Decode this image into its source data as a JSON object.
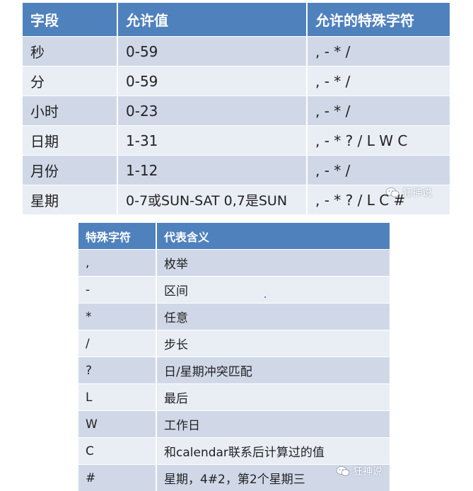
{
  "fields_table": {
    "headers": [
      "字段",
      "允许值",
      "允许的特殊字符"
    ],
    "rows": [
      [
        "秒",
        "0-59",
        ", - * /"
      ],
      [
        "分",
        "0-59",
        ", - * /"
      ],
      [
        "小时",
        "0-23",
        ", - * /"
      ],
      [
        "日期",
        "1-31",
        ", - * ? / L W C"
      ],
      [
        "月份",
        "1-12",
        ", - * /"
      ],
      [
        "星期",
        "0-7或SUN-SAT 0,7是SUN",
        ", - * ? / L C #"
      ]
    ]
  },
  "special_chars_table": {
    "headers": [
      "特殊字符",
      "代表含义"
    ],
    "rows": [
      [
        ",",
        "枚举"
      ],
      [
        "-",
        "区间"
      ],
      [
        "*",
        "任意"
      ],
      [
        "/",
        "步长"
      ],
      [
        "?",
        "日/星期冲突匹配"
      ],
      [
        "L",
        "最后"
      ],
      [
        "W",
        "工作日"
      ],
      [
        "C",
        "和calendar联系后计算过的值"
      ],
      [
        "#",
        "星期，4#2，第2个星期三"
      ]
    ]
  },
  "watermark": {
    "text": "狂神说",
    "icon": "wechat-icon"
  },
  "colors": {
    "header": "#4f81bd",
    "row_dark": "#d0d8e8",
    "row_light": "#e9edf4"
  }
}
